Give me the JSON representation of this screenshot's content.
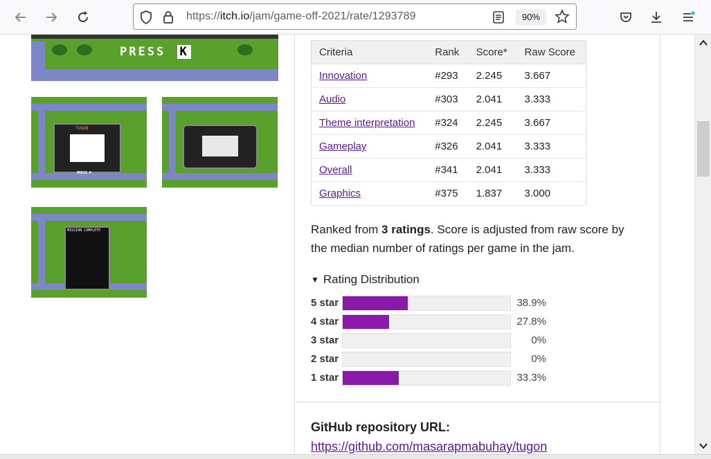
{
  "browser": {
    "url_prefix": "https://",
    "url_host": "itch.io",
    "url_path": "/jam/game-off-2021/rate/1293789",
    "zoom": "90%",
    "icons": [
      "back-arrow-icon",
      "forward-arrow-icon",
      "reload-icon",
      "shield-icon",
      "lock-icon",
      "reader-view-icon",
      "bookmark-star-icon",
      "pocket-icon",
      "download-icon",
      "menu-icon"
    ]
  },
  "screenshots": {
    "press_key_label": "PRESS",
    "press_key": "K",
    "small_press_label": "PRESS K",
    "thumb1_title": "TUGON",
    "thumb3_title": "MISSION COMPLETE"
  },
  "results": {
    "headers": [
      "Criteria",
      "Rank",
      "Score*",
      "Raw Score"
    ],
    "rows": [
      {
        "criteria": "Innovation",
        "rank": "#293",
        "score": "2.245",
        "raw": "3.667"
      },
      {
        "criteria": "Audio",
        "rank": "#303",
        "score": "2.041",
        "raw": "3.333"
      },
      {
        "criteria": "Theme interpretation",
        "rank": "#324",
        "score": "2.245",
        "raw": "3.667"
      },
      {
        "criteria": "Gameplay",
        "rank": "#326",
        "score": "2.041",
        "raw": "3.333"
      },
      {
        "criteria": "Overall",
        "rank": "#341",
        "score": "2.041",
        "raw": "3.333"
      },
      {
        "criteria": "Graphics",
        "rank": "#375",
        "score": "1.837",
        "raw": "3.000"
      }
    ],
    "ranked_prefix": "Ranked from ",
    "ranked_count": "3 ratings",
    "ranked_suffix": ". Score is adjusted from raw score by the median number of ratings per game in the jam."
  },
  "distribution": {
    "heading": "Rating Distribution",
    "accent_color": "#8a18a8",
    "rows": [
      {
        "label": "5 star",
        "percent": "38.9%",
        "fraction": 0.389
      },
      {
        "label": "4 star",
        "percent": "27.8%",
        "fraction": 0.278
      },
      {
        "label": "3 star",
        "percent": "0%",
        "fraction": 0
      },
      {
        "label": "2 star",
        "percent": "0%",
        "fraction": 0
      },
      {
        "label": "1 star",
        "percent": "33.3%",
        "fraction": 0.333
      }
    ]
  },
  "github": {
    "label": "GitHub repository URL:",
    "link": "https://github.com/masarapmabuhay/tugon"
  }
}
